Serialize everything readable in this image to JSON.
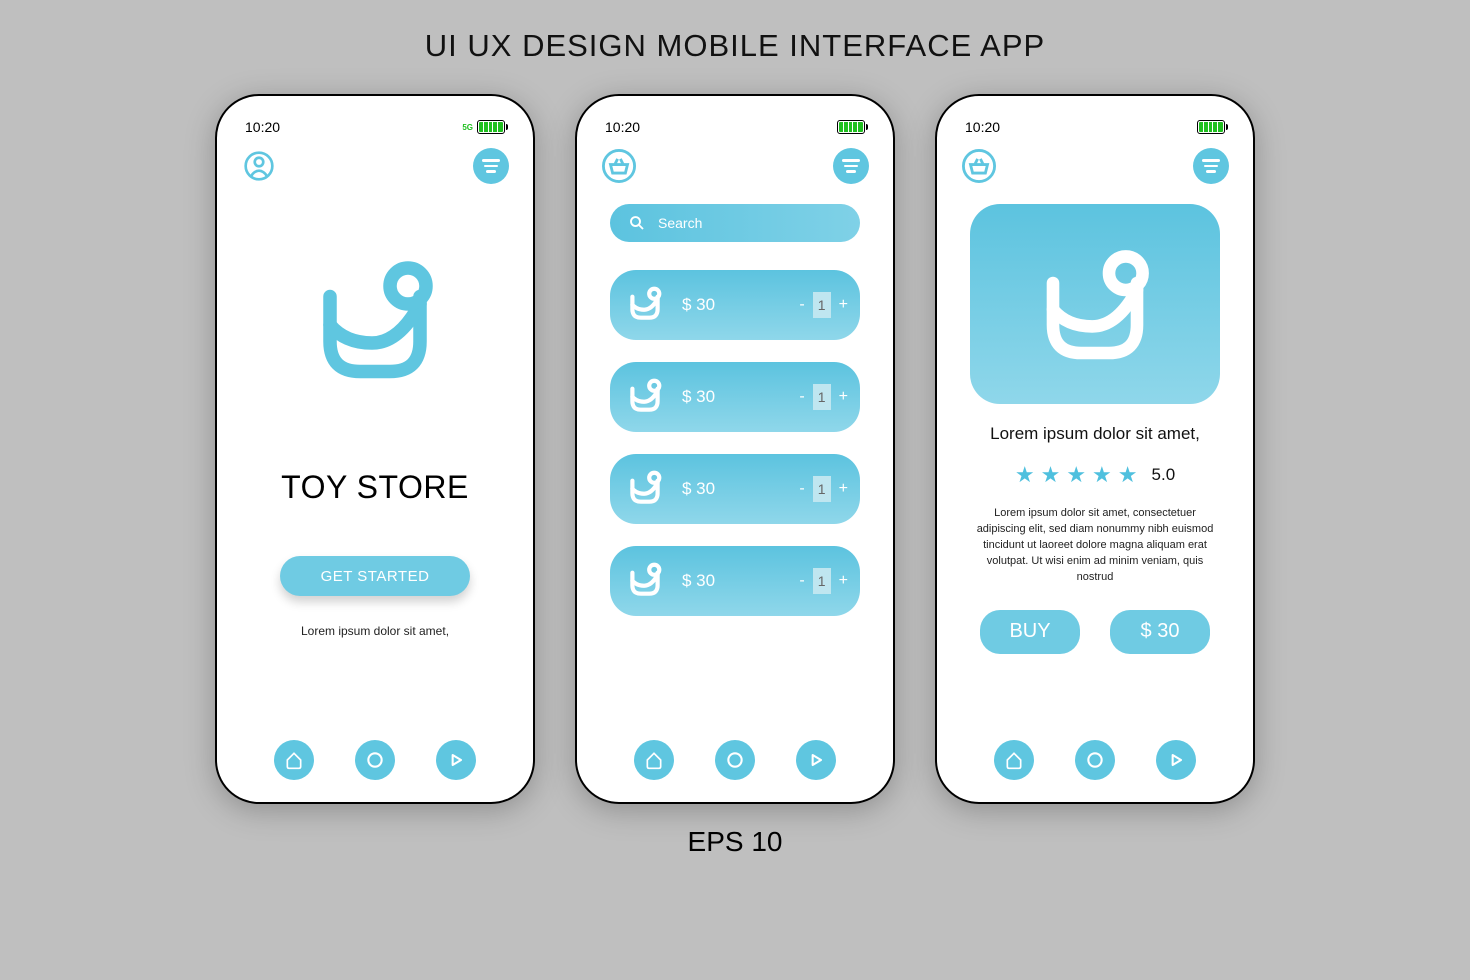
{
  "heading": "UI UX DESIGN MOBILE INTERFACE APP",
  "footer": "EPS 10",
  "status": {
    "time": "10:20",
    "signal": "5G"
  },
  "screen1": {
    "title": "TOY STORE",
    "cta": "GET STARTED",
    "subtitle": "Lorem ipsum dolor sit amet,"
  },
  "screen2": {
    "search_placeholder": "Search",
    "items": [
      {
        "price": "$ 30",
        "qty": "1"
      },
      {
        "price": "$ 30",
        "qty": "1"
      },
      {
        "price": "$ 30",
        "qty": "1"
      },
      {
        "price": "$ 30",
        "qty": "1"
      }
    ],
    "minus": "-",
    "plus": "+"
  },
  "screen3": {
    "name": "Lorem ipsum dolor sit amet,",
    "rating": "5.0",
    "desc": "Lorem ipsum dolor sit amet, consectetuer adipiscing elit, sed diam nonummy nibh euismod tincidunt ut laoreet dolore magna aliquam erat volutpat. Ut wisi enim ad minim veniam, quis nostrud",
    "buy": "BUY",
    "price": "$ 30"
  }
}
